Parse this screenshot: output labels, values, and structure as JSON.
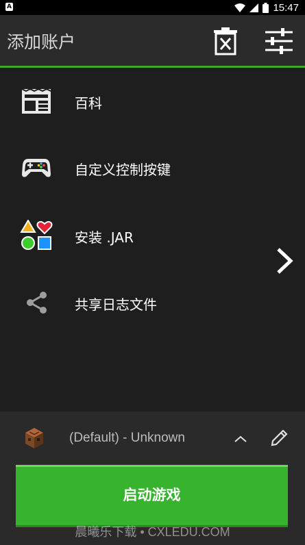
{
  "status_bar": {
    "time": "15:47",
    "app_icon_letter": "A",
    "icons": [
      "wifi-icon",
      "signal-icon",
      "battery-icon"
    ]
  },
  "toolbar": {
    "title": "添加账户",
    "delete_icon": "delete-account-icon",
    "settings_icon": "settings-sliders-icon"
  },
  "accent_color": "#43a52d",
  "menu": {
    "items": [
      {
        "label": "百科",
        "icon": "wiki-icon"
      },
      {
        "label": "自定义控制按键",
        "icon": "gamepad-icon"
      },
      {
        "label": "安装 .JAR",
        "icon": "install-jar-icon"
      },
      {
        "label": "共享日志文件",
        "icon": "share-icon"
      }
    ],
    "next_icon": "chevron-right-icon"
  },
  "profile": {
    "label": "(Default) - Unknown",
    "icon": "crafting-table-icon"
  },
  "launch_button": {
    "label": "启动游戏",
    "color": "#37b32e"
  },
  "watermark": "晨曦乐下载 • CXLEDU.COM"
}
